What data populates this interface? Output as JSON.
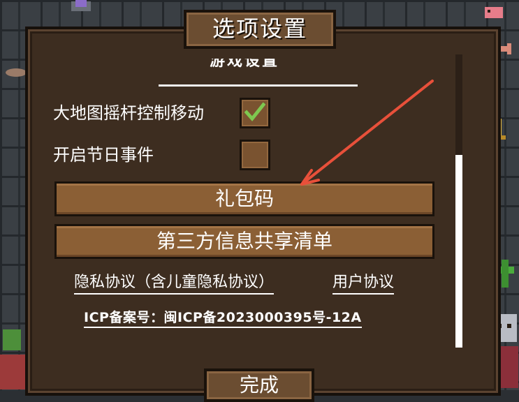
{
  "dialog": {
    "title": "选项设置",
    "section_heading": "游戏设置"
  },
  "options": [
    {
      "label": "大地图摇杆控制移动",
      "checked": true
    },
    {
      "label": "开启节日事件",
      "checked": false
    }
  ],
  "buttons": {
    "gift_code": "礼包码",
    "third_party_list": "第三方信息共享清单"
  },
  "links": {
    "privacy": "隐私协议（含儿童隐私协议）",
    "user_agreement": "用户协议"
  },
  "icp": "ICP备案号：闽ICP备2023000395号-12A",
  "done": "完成",
  "colors": {
    "panel": "#3d2d20",
    "button": "#8b5f35",
    "checkmark": "#7ec850",
    "arrow": "#e8503a"
  }
}
